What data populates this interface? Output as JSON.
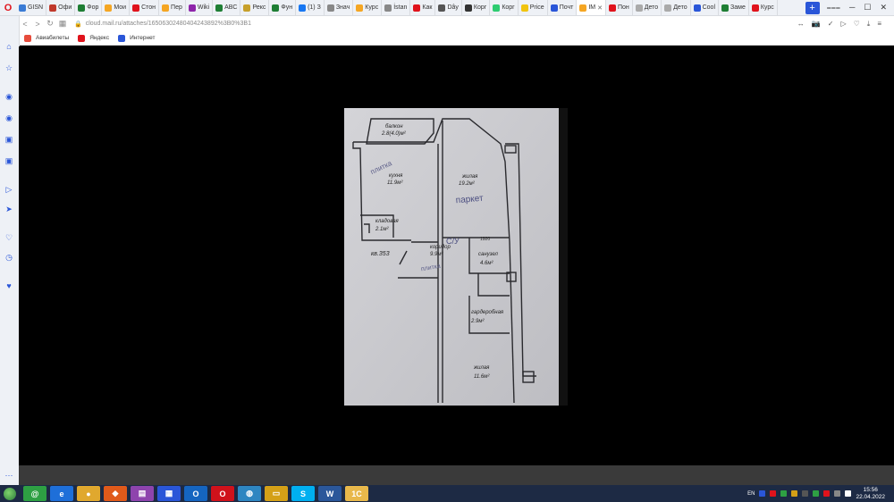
{
  "browser": {
    "logo": "O",
    "tabs": [
      {
        "label": "GISN",
        "icon": "drop-icon",
        "color": "#3a7bd5"
      },
      {
        "label": "Офи",
        "icon": "document-icon",
        "color": "#c0392b"
      },
      {
        "label": "Фор",
        "icon": "spreadsheet-icon",
        "color": "#1e7e34"
      },
      {
        "label": "Мои",
        "icon": "smile-icon",
        "color": "#f5a623"
      },
      {
        "label": "Стон",
        "icon": "circle-icon",
        "color": "#e0131c"
      },
      {
        "label": "Пер",
        "icon": "smile-icon",
        "color": "#f5a623"
      },
      {
        "label": "Wiki",
        "icon": "wiki-icon",
        "color": "#8e24aa"
      },
      {
        "label": "ABC",
        "icon": "spreadsheet-icon",
        "color": "#1e7e34"
      },
      {
        "label": "Рекс",
        "icon": "smile-icon",
        "color": "#c7a02b"
      },
      {
        "label": "Фун",
        "icon": "spreadsheet-icon",
        "color": "#1e7e34"
      },
      {
        "label": "(1) З",
        "icon": "facebook-icon",
        "color": "#1877f2"
      },
      {
        "label": "Знач",
        "icon": "shape-icon",
        "color": "#888888"
      },
      {
        "label": "Курс",
        "icon": "shape-icon",
        "color": "#f5a623"
      },
      {
        "label": "İstan",
        "icon": "shape-icon",
        "color": "#888888"
      },
      {
        "label": "Как",
        "icon": "flag-icon",
        "color": "#e0131c"
      },
      {
        "label": "Dây",
        "icon": "circle-icon",
        "color": "#555555"
      },
      {
        "label": "Корг",
        "icon": "square-icon",
        "color": "#333333"
      },
      {
        "label": "Корг",
        "icon": "square-icon",
        "color": "#2ecc71"
      },
      {
        "label": "Price",
        "icon": "square-icon",
        "color": "#f1c40f"
      },
      {
        "label": "Почт",
        "icon": "mail-icon",
        "color": "#2a56d8"
      },
      {
        "label": "IM",
        "icon": "cloud-icon",
        "color": "#f5a623",
        "active": true
      },
      {
        "label": "Пон",
        "icon": "square-icon",
        "color": "#e0131c"
      },
      {
        "label": "Дето",
        "icon": "circle-icon",
        "color": "#aaaaaa"
      },
      {
        "label": "Дето",
        "icon": "square-icon",
        "color": "#aaaaaa"
      },
      {
        "label": "Cool",
        "icon": "square-icon",
        "color": "#2a56d8"
      },
      {
        "label": "Заме",
        "icon": "circle-icon",
        "color": "#1e7e34"
      },
      {
        "label": "Курс",
        "icon": "shape-icon",
        "color": "#e0131c"
      }
    ],
    "newtab_label": "+",
    "window_controls": [
      "⩶",
      "─",
      "☐",
      "✕"
    ]
  },
  "address_bar": {
    "url": "cloud.mail.ru/attaches/16506302480404243892%3B0%3B1",
    "right_icons": [
      "↔",
      "📷",
      "✓",
      "▷",
      "♡",
      "⤓",
      "≡"
    ]
  },
  "bookmarks": [
    {
      "label": "Авиабилеты",
      "icon": "plane-icon",
      "color": "#e74c3c"
    },
    {
      "label": "Яндекс",
      "icon": "yandex-icon",
      "color": "#e0131c"
    },
    {
      "label": "Интернет",
      "icon": "globe-icon",
      "color": "#2a56d8"
    }
  ],
  "sidebar": {
    "items": [
      {
        "name": "home-icon",
        "glyph": "⌂"
      },
      {
        "name": "star-icon",
        "glyph": "☆"
      },
      {
        "name": "messenger-icon",
        "glyph": "◉"
      },
      {
        "name": "whatsapp-icon",
        "glyph": "◉"
      },
      {
        "name": "vk-icon",
        "glyph": "▣"
      },
      {
        "name": "instagram-icon",
        "glyph": "▣"
      },
      {
        "name": "player-icon",
        "glyph": "▷"
      },
      {
        "name": "send-icon",
        "glyph": "➤"
      },
      {
        "name": "heart-icon",
        "glyph": "♡"
      },
      {
        "name": "history-icon",
        "glyph": "◷"
      },
      {
        "name": "pin-icon",
        "glyph": "♥"
      },
      {
        "name": "more-icon",
        "glyph": "···"
      }
    ]
  },
  "floorplan": {
    "balcony": "балкон\n2.8(4.0)м²",
    "kitchen": "кухня\n11.9м²",
    "kitchen_note": "плитка",
    "living1": "жилая\n19.2м²",
    "living1_note": "паркет",
    "pantry": "кладовая\n2.1м²",
    "apartment": "кв.353",
    "corridor": "коридор\n9.9м²",
    "corridor_note": "плитка",
    "bathroom_mark": "С/У",
    "width_mark": "1920",
    "bathroom": "санузел\n4.6м²",
    "wardrobe": "гардеробная\n2.9м²",
    "living2": "жилая\n11.6м²"
  },
  "taskbar": {
    "apps": [
      {
        "name": "mail-agent-app",
        "glyph": "@",
        "color": "#2ea043"
      },
      {
        "name": "ie-app",
        "glyph": "e",
        "color": "#1e6fd9"
      },
      {
        "name": "chrome-app",
        "glyph": "●",
        "color": "#e0a82e"
      },
      {
        "name": "brave-app",
        "glyph": "◆",
        "color": "#e05a1a"
      },
      {
        "name": "winrar-app",
        "glyph": "▤",
        "color": "#8e44ad"
      },
      {
        "name": "save-app",
        "glyph": "▦",
        "color": "#2a56d8"
      },
      {
        "name": "outlook-app",
        "glyph": "O",
        "color": "#1565c0"
      },
      {
        "name": "opera-app",
        "glyph": "O",
        "color": "#d0121b"
      },
      {
        "name": "media-app",
        "glyph": "◍",
        "color": "#2e86c1"
      },
      {
        "name": "explorer-app",
        "glyph": "▭",
        "color": "#d4a017"
      },
      {
        "name": "skype-app",
        "glyph": "S",
        "color": "#00aff0"
      },
      {
        "name": "word-app",
        "glyph": "W",
        "color": "#2b579a"
      },
      {
        "name": "onec-app",
        "glyph": "1С",
        "color": "#e8b84b"
      }
    ],
    "lang": "EN",
    "time": "15:56",
    "date": "22.04.2022"
  }
}
